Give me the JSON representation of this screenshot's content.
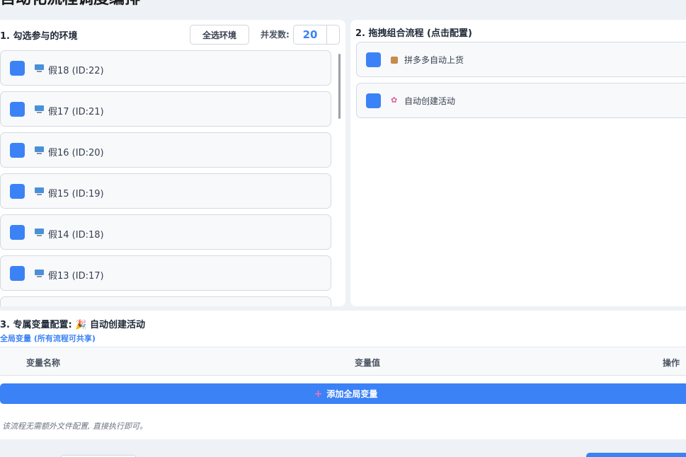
{
  "page": {
    "title": "自动化流程调度编排"
  },
  "env_panel": {
    "title": "1. 勾选参与的环境",
    "select_all_label": "全选环境",
    "concurrency_label": "并发数:",
    "concurrency_value": "20",
    "items": [
      {
        "label": "假18 (ID:22)",
        "checked": true
      },
      {
        "label": "假17 (ID:21)",
        "checked": true
      },
      {
        "label": "假16 (ID:20)",
        "checked": true
      },
      {
        "label": "假15 (ID:19)",
        "checked": true
      },
      {
        "label": "假14 (ID:18)",
        "checked": true
      },
      {
        "label": "假13 (ID:17)",
        "checked": true
      }
    ]
  },
  "flow_panel": {
    "title": "2. 拖拽组合流程 (点击配置)",
    "items": [
      {
        "label": "拼多多自动上货",
        "icon": "package-icon",
        "checked": true
      },
      {
        "label": "自动创建活动",
        "icon": "party-popper-icon",
        "checked": true
      }
    ]
  },
  "vars_panel": {
    "title": "3. 专属变量配置: 🎉 自动创建活动",
    "global_vars_label": "全局变量 (所有流程可共享)",
    "columns": [
      "变量名称",
      "变量值",
      "操作"
    ],
    "add_button_label": "添加全局变量",
    "no_config_text": "该流程无需额外文件配置, 直接执行即可。"
  },
  "colors": {
    "accent": "#3b82f6",
    "background": "#eef1f5",
    "panel": "#ffffff"
  }
}
